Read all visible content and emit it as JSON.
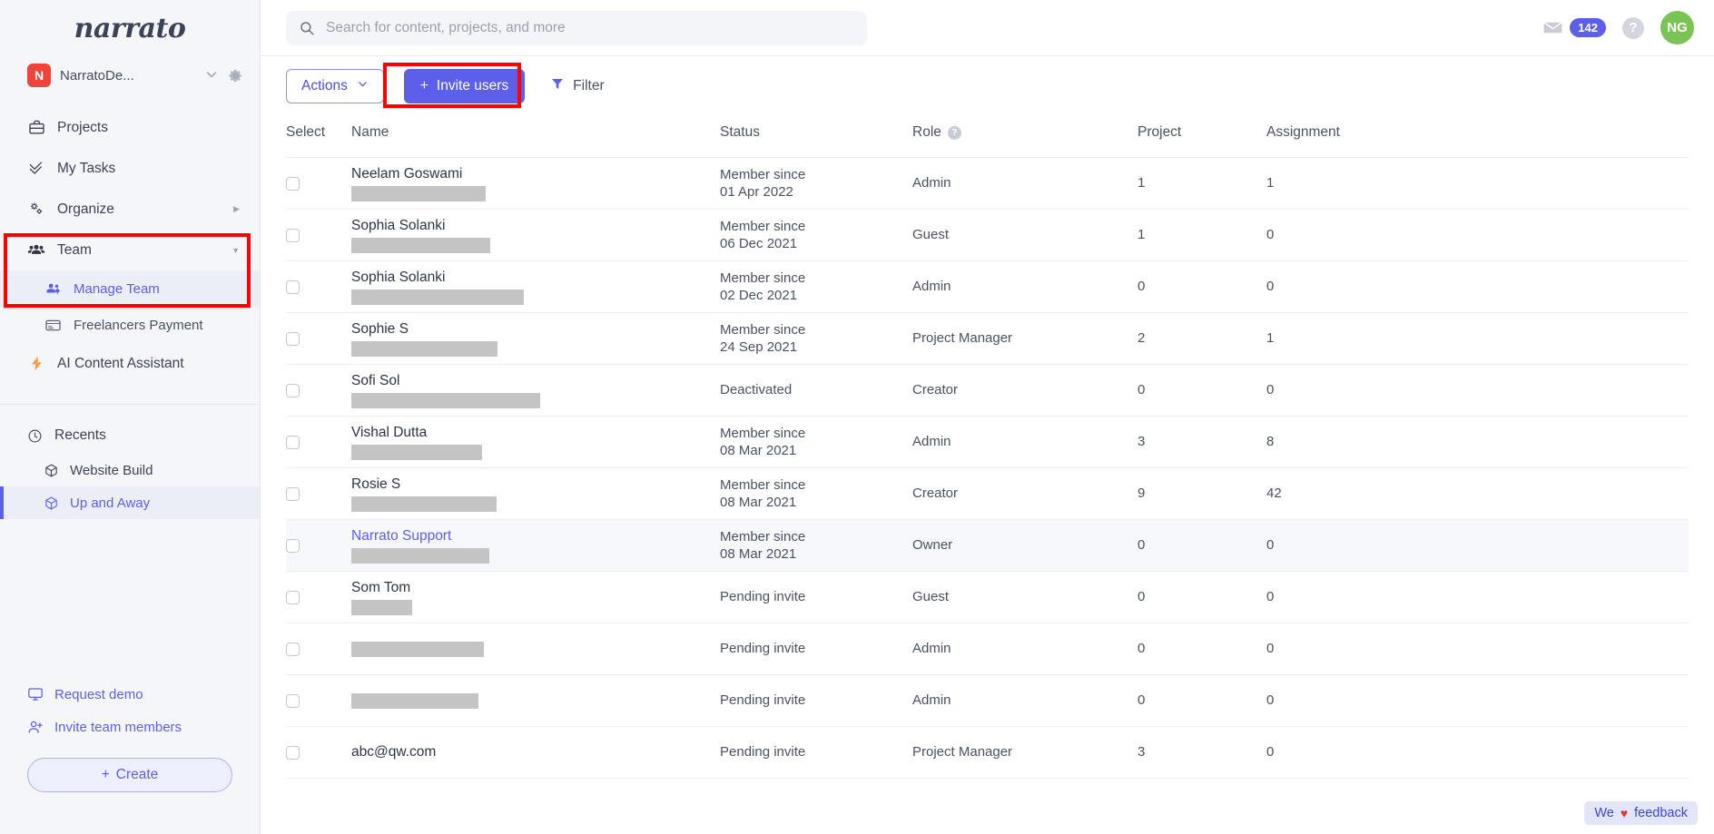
{
  "sidebar": {
    "brand": "narrato",
    "workspace": {
      "initial": "N",
      "name": "NarratoDe...",
      "caret": "chevron-down-icon",
      "gear": "gear-icon"
    },
    "nav": [
      {
        "label": "Projects",
        "icon": "briefcase-icon"
      },
      {
        "label": "My Tasks",
        "icon": "double-check-icon"
      },
      {
        "label": "Organize",
        "icon": "gears-icon",
        "arrow": "▶"
      },
      {
        "label": "Team",
        "icon": "team-icon",
        "arrow": "▼"
      }
    ],
    "team_children": [
      {
        "label": "Manage Team",
        "icon": "manage-team-icon",
        "active": true
      },
      {
        "label": "Freelancers Payment",
        "icon": "payment-card-icon",
        "active": false
      }
    ],
    "ai_item": {
      "label": "AI Content Assistant",
      "icon": "lightning-icon"
    },
    "recents": {
      "label": "Recents",
      "icon": "clock-icon",
      "items": [
        {
          "label": "Website Build",
          "icon": "cube-icon",
          "active": false
        },
        {
          "label": "Up and Away",
          "icon": "cube-icon",
          "active": true
        }
      ]
    },
    "bottom": [
      {
        "label": "Request demo",
        "icon": "monitor-icon"
      },
      {
        "label": "Invite team members",
        "icon": "user-plus-icon"
      }
    ],
    "create_button": {
      "label": "Create",
      "plus": "+"
    }
  },
  "topbar": {
    "search": {
      "placeholder": "Search for content, projects, and more",
      "value": "",
      "icon": "search-icon"
    },
    "mail": {
      "icon": "mail-icon",
      "badge": "142"
    },
    "help": {
      "icon": "question-mark-icon",
      "glyph": "?"
    },
    "avatar": {
      "initials": "NG",
      "color": "#7ac455"
    }
  },
  "toolbar": {
    "actions_label": "Actions",
    "actions_caret": "∨",
    "invite_label": "Invite users",
    "invite_plus": "+",
    "filter_label": "Filter",
    "filter_icon": "funnel-icon"
  },
  "table": {
    "columns": [
      "Select",
      "Name",
      "Status",
      "Role",
      "Project",
      "Assignment"
    ],
    "role_tooltip_glyph": "?",
    "rows": [
      {
        "name": "Neelam Goswami",
        "redact_w": 148,
        "status_line1": "Member since",
        "status_line2": "01 Apr 2022",
        "role": "Admin",
        "project": "1",
        "assignment": "1",
        "highlight": false,
        "link": false
      },
      {
        "name": "Sophia Solanki",
        "redact_w": 153,
        "status_line1": "Member since",
        "status_line2": "06 Dec 2021",
        "role": "Guest",
        "project": "1",
        "assignment": "0",
        "highlight": false,
        "link": false
      },
      {
        "name": "Sophia Solanki",
        "redact_w": 190,
        "status_line1": "Member since",
        "status_line2": "02 Dec 2021",
        "role": "Admin",
        "project": "0",
        "assignment": "0",
        "highlight": false,
        "link": false
      },
      {
        "name": "Sophie S",
        "redact_w": 161,
        "status_line1": "Member since",
        "status_line2": "24 Sep 2021",
        "role": "Project Manager",
        "project": "2",
        "assignment": "1",
        "highlight": false,
        "link": false
      },
      {
        "name": "Sofi Sol",
        "redact_w": 208,
        "status_line1": "Deactivated",
        "status_line2": "",
        "role": "Creator",
        "project": "0",
        "assignment": "0",
        "highlight": false,
        "link": false
      },
      {
        "name": "Vishal Dutta",
        "redact_w": 144,
        "status_line1": "Member since",
        "status_line2": "08 Mar 2021",
        "role": "Admin",
        "project": "3",
        "assignment": "8",
        "highlight": false,
        "link": false
      },
      {
        "name": "Rosie S",
        "redact_w": 160,
        "status_line1": "Member since",
        "status_line2": "08 Mar 2021",
        "role": "Creator",
        "project": "9",
        "assignment": "42",
        "highlight": false,
        "link": false
      },
      {
        "name": "Narrato Support",
        "redact_w": 152,
        "status_line1": "Member since",
        "status_line2": "08 Mar 2021",
        "role": "Owner",
        "project": "0",
        "assignment": "0",
        "highlight": true,
        "link": true
      },
      {
        "name": "Som Tom",
        "redact_w": 67,
        "status_line1": "Pending invite",
        "status_line2": "",
        "role": "Guest",
        "project": "0",
        "assignment": "0",
        "highlight": false,
        "link": false
      },
      {
        "name": "",
        "redact_w": 146,
        "status_line1": "Pending invite",
        "status_line2": "",
        "role": "Admin",
        "project": "0",
        "assignment": "0",
        "highlight": false,
        "link": false
      },
      {
        "name": "",
        "redact_w": 140,
        "status_line1": "Pending invite",
        "status_line2": "",
        "role": "Admin",
        "project": "0",
        "assignment": "0",
        "highlight": false,
        "link": false
      },
      {
        "name": "abc@qw.com",
        "redact_w": 0,
        "status_line1": "Pending invite",
        "status_line2": "",
        "role": "Project Manager",
        "project": "3",
        "assignment": "0",
        "highlight": false,
        "link": false
      }
    ]
  },
  "feedback": {
    "pre": "We",
    "heart": "♥",
    "post": "feedback"
  },
  "colors": {
    "accent": "#5b5fe9",
    "annotation": "#ff0000",
    "avatar": "#7ac455",
    "workspace_badge": "#f04438"
  }
}
